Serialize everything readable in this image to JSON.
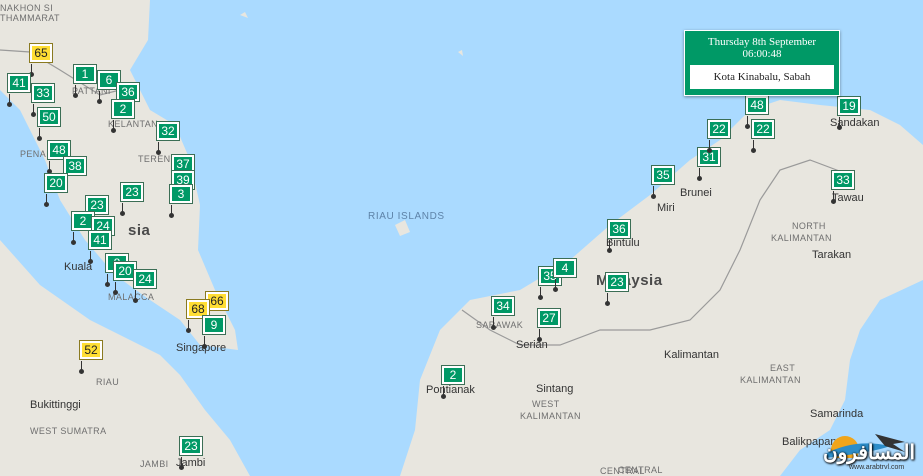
{
  "map": {
    "water_color": "#aadaff",
    "land_color": "#e8e6df",
    "good_color": "#009966",
    "moderate_color": "#ffde33",
    "labels": [
      {
        "id": "nakhon",
        "text": "NAKHON SI",
        "cls": "small"
      },
      {
        "id": "thammarat",
        "text": "THAMMARAT",
        "cls": "small"
      },
      {
        "id": "pattani",
        "text": "PATTANI",
        "cls": "small"
      },
      {
        "id": "kelantan",
        "text": "KELANTAN",
        "cls": "small"
      },
      {
        "id": "terengganu",
        "text": "TERENG",
        "cls": "small"
      },
      {
        "id": "penang",
        "text": "PENA",
        "cls": "small"
      },
      {
        "id": "malaysia-west",
        "text": "sia",
        "cls": "country"
      },
      {
        "id": "kuala",
        "text": "Kuala",
        "cls": "city"
      },
      {
        "id": "malacca",
        "text": "MALACCA",
        "cls": "small"
      },
      {
        "id": "riau-islands",
        "text": "RIAU ISLANDS",
        "cls": "sea"
      },
      {
        "id": "singapore",
        "text": "Singapore",
        "cls": "city"
      },
      {
        "id": "riau",
        "text": "RIAU",
        "cls": "small"
      },
      {
        "id": "bukittinggi",
        "text": "Bukittinggi",
        "cls": "city"
      },
      {
        "id": "west-sumatra",
        "text": "WEST SUMATRA",
        "cls": "small"
      },
      {
        "id": "jambi-region",
        "text": "JAMBI",
        "cls": "small"
      },
      {
        "id": "jambi",
        "text": "Jambi",
        "cls": "city"
      },
      {
        "id": "sarawak",
        "text": "SARAWAK",
        "cls": "small"
      },
      {
        "id": "serian",
        "text": "Serian",
        "cls": "city"
      },
      {
        "id": "pontianak",
        "text": "Pontianak",
        "cls": "city"
      },
      {
        "id": "sintang",
        "text": "Sintang",
        "cls": "city"
      },
      {
        "id": "west-kal-1",
        "text": "WEST",
        "cls": "small"
      },
      {
        "id": "west-kal-2",
        "text": "KALIMANTAN",
        "cls": "small"
      },
      {
        "id": "central-1",
        "text": "CENTRAL",
        "cls": "small"
      },
      {
        "id": "kalimantan",
        "text": "Kalimantan",
        "cls": "city"
      },
      {
        "id": "bintulu",
        "text": "Bintulu",
        "cls": "city"
      },
      {
        "id": "miri",
        "text": "Miri",
        "cls": "city"
      },
      {
        "id": "brunei",
        "text": "Brunei",
        "cls": "city"
      },
      {
        "id": "malaysia-east",
        "text": "Malaysia",
        "cls": "country"
      },
      {
        "id": "sandakan",
        "text": "Sandakan",
        "cls": "city"
      },
      {
        "id": "tawau",
        "text": "Tawau",
        "cls": "city"
      },
      {
        "id": "north-kal-1",
        "text": "NORTH",
        "cls": "small"
      },
      {
        "id": "north-kal-2",
        "text": "KALIMANTAN",
        "cls": "small"
      },
      {
        "id": "tarakan",
        "text": "Tarakan",
        "cls": "city"
      },
      {
        "id": "east-kal-1",
        "text": "EAST",
        "cls": "small"
      },
      {
        "id": "east-kal-2",
        "text": "KALIMANTAN",
        "cls": "small"
      },
      {
        "id": "samarinda",
        "text": "Samarinda",
        "cls": "city"
      },
      {
        "id": "balikpapan",
        "text": "Balikpapan",
        "cls": "city"
      },
      {
        "id": "central-2",
        "text": "CENTRAL",
        "cls": "small"
      }
    ],
    "markers": [
      {
        "value": "65",
        "level": "moderate"
      },
      {
        "value": "41",
        "level": "good"
      },
      {
        "value": "1",
        "level": "good"
      },
      {
        "value": "6",
        "level": "good"
      },
      {
        "value": "33",
        "level": "good"
      },
      {
        "value": "36",
        "level": "good"
      },
      {
        "value": "2",
        "level": "good"
      },
      {
        "value": "50",
        "level": "good"
      },
      {
        "value": "32",
        "level": "good"
      },
      {
        "value": "48",
        "level": "good"
      },
      {
        "value": "38",
        "level": "good"
      },
      {
        "value": "37",
        "level": "good"
      },
      {
        "value": "20",
        "level": "good"
      },
      {
        "value": "39",
        "level": "good"
      },
      {
        "value": "23",
        "level": "good"
      },
      {
        "value": "3",
        "level": "good"
      },
      {
        "value": "23",
        "level": "good"
      },
      {
        "value": "2",
        "level": "good"
      },
      {
        "value": "24",
        "level": "good"
      },
      {
        "value": "41",
        "level": "good"
      },
      {
        "value": "8",
        "level": "good"
      },
      {
        "value": "20",
        "level": "good"
      },
      {
        "value": "24",
        "level": "good"
      },
      {
        "value": "66",
        "level": "moderate"
      },
      {
        "value": "68",
        "level": "moderate"
      },
      {
        "value": "9",
        "level": "good"
      },
      {
        "value": "52",
        "level": "moderate"
      },
      {
        "value": "23",
        "level": "good"
      },
      {
        "value": "34",
        "level": "good"
      },
      {
        "value": "35",
        "level": "good"
      },
      {
        "value": "4",
        "level": "good"
      },
      {
        "value": "27",
        "level": "good"
      },
      {
        "value": "2",
        "level": "good"
      },
      {
        "value": "36",
        "level": "good"
      },
      {
        "value": "23",
        "level": "good"
      },
      {
        "value": "35",
        "level": "good"
      },
      {
        "value": "31",
        "level": "good"
      },
      {
        "value": "22",
        "level": "good"
      },
      {
        "value": "22",
        "level": "good"
      },
      {
        "value": "48",
        "level": "good"
      },
      {
        "value": "19",
        "level": "good"
      },
      {
        "value": "33",
        "level": "good"
      }
    ]
  },
  "info_window": {
    "date": "Thursday 8th September",
    "time": "06:00:48",
    "place": "Kota Kinabalu, Sabah"
  },
  "watermark": {
    "text": "المسافرون",
    "url": "www.arabtrvl.com"
  }
}
